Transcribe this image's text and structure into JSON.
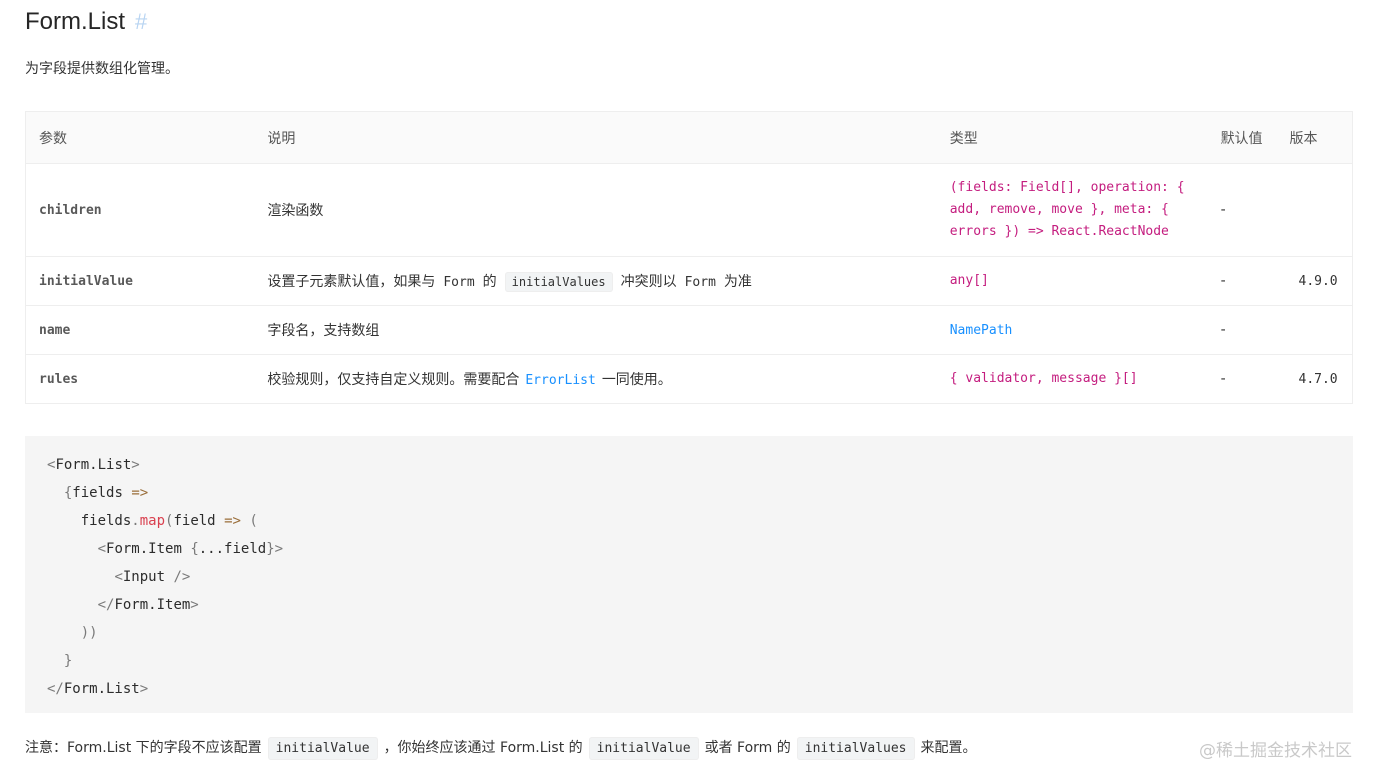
{
  "header": {
    "title": "Form.List",
    "anchor": "#",
    "description": "为字段提供数组化管理。"
  },
  "table": {
    "columns": [
      "参数",
      "说明",
      "类型",
      "默认值",
      "版本"
    ],
    "rows": [
      {
        "param": "children",
        "desc": "渲染函数",
        "type_lines": [
          "(fields: Field[], operation: {",
          "add, remove, move }, meta: {",
          "errors }) => React.ReactNode"
        ],
        "default": "-",
        "version": ""
      },
      {
        "param": "initialValue",
        "desc_parts": [
          "设置子元素默认值，如果与",
          "Form",
          "的",
          "initialValues",
          "冲突则以",
          "Form",
          "为准"
        ],
        "type": "any[]",
        "default": "-",
        "version": "4.9.0"
      },
      {
        "param": "name",
        "desc": "字段名，支持数组",
        "type": "NamePath",
        "default": "-",
        "version": ""
      },
      {
        "param": "rules",
        "desc_parts": [
          "校验规则，仅支持自定义规则。需要配合",
          "ErrorList",
          "一同使用。"
        ],
        "type": "{ validator, message }[]",
        "default": "-",
        "version": "4.7.0"
      }
    ]
  },
  "code": {
    "tag_open": "Form.List",
    "fields_var": "fields",
    "arrow": "=>",
    "map_fn": "map",
    "field_var": "field",
    "item_tag": "Form.Item",
    "spread": "...field",
    "input_tag": "Input"
  },
  "note": {
    "prefix": "注意：Form.List 下的字段不应该配置",
    "chip1": "initialValue",
    "mid1": "，你始终应该通过 Form.List 的",
    "chip2": "initialValue",
    "mid2": "或者 Form 的",
    "chip3": "initialValues",
    "suffix": "来配置。"
  },
  "watermark": "@稀土掘金技术社区",
  "colors": {
    "type_magenta": "#c41d7f",
    "link_blue": "#1890ff",
    "anchor_blue": "#b8d4f2",
    "code_bg": "#f5f5f5"
  }
}
